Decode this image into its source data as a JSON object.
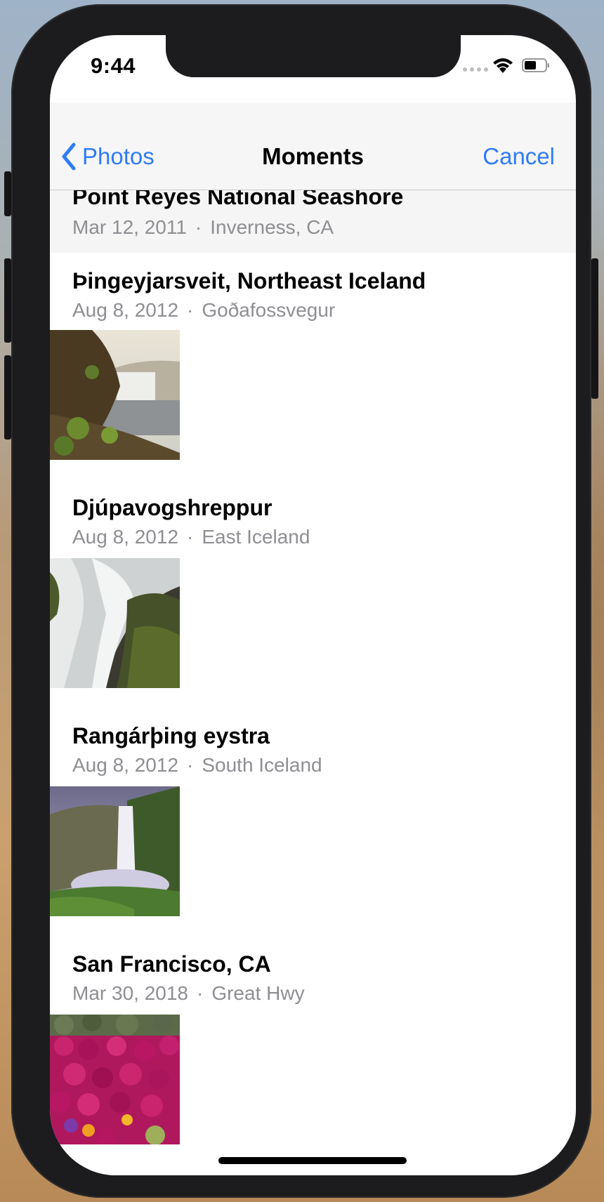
{
  "status_bar": {
    "time": "9:44"
  },
  "nav": {
    "back_label": "Photos",
    "title": "Moments",
    "cancel_label": "Cancel"
  },
  "header_moment": {
    "title": "Point Reyes National Seashore",
    "date": "Mar 12, 2011",
    "location": "Inverness, CA"
  },
  "moments": [
    {
      "title": "Þingeyjarsveit, Northeast Iceland",
      "date": "Aug 8, 2012",
      "location": "Goðafossvegur"
    },
    {
      "title": "Djúpavogshreppur",
      "date": "Aug 8, 2012",
      "location": "East Iceland"
    },
    {
      "title": "Rangárþing eystra",
      "date": "Aug 8, 2012",
      "location": "South Iceland"
    },
    {
      "title": "San Francisco, CA",
      "date": "Mar 30, 2018",
      "location": "Great Hwy"
    }
  ],
  "separator": "·",
  "colors": {
    "accent": "#2f7cf6",
    "secondary_text": "#8e8e93"
  }
}
